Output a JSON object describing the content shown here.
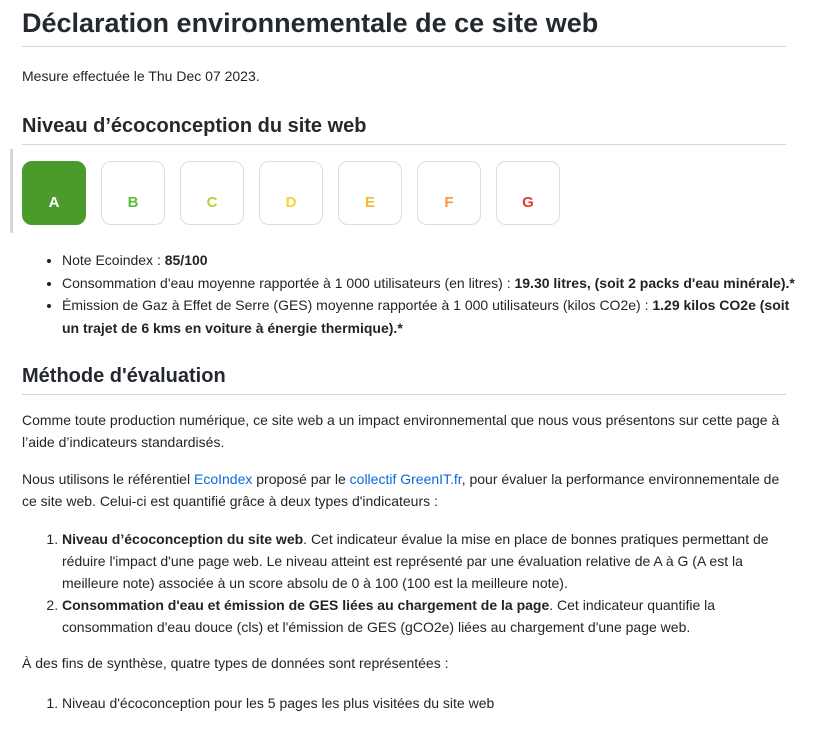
{
  "title": "Déclaration environnementale de ce site web",
  "measure_text": "Mesure effectuée le Thu Dec 07 2023.",
  "level_heading": "Niveau d’écoconception du site web",
  "grades": [
    {
      "letter": "A",
      "color": "#4a9a2c",
      "active": true
    },
    {
      "letter": "B",
      "color": "#5fbd3c",
      "active": false
    },
    {
      "letter": "C",
      "color": "#b5d334",
      "active": false
    },
    {
      "letter": "D",
      "color": "#f1d62b",
      "active": false
    },
    {
      "letter": "E",
      "color": "#f5b731",
      "active": false
    },
    {
      "letter": "F",
      "color": "#f19a40",
      "active": false
    },
    {
      "letter": "G",
      "color": "#e53935",
      "active": false
    }
  ],
  "notes": [
    {
      "text": "Note Ecoindex : ",
      "bold": "85/100"
    },
    {
      "text": "Consommation d'eau moyenne rapportée à 1 000 utilisateurs (en litres) : ",
      "bold": "19.30 litres, (soit 2 packs d'eau minérale).*"
    },
    {
      "text": "Émission de Gaz à Effet de Serre (GES) moyenne rapportée à 1 000 utilisateurs (kilos CO2e) : ",
      "bold": "1.29 kilos CO2e (soit un trajet de 6 kms en voiture à énergie thermique).*"
    }
  ],
  "method_heading": "Méthode d'évaluation",
  "para1": "Comme toute production numérique, ce site web a un impact environnemental que nous vous présentons sur cette page à l’aide d’indicateurs standardisés.",
  "para2": {
    "before": "Nous utilisons le référentiel ",
    "link1": "EcoIndex",
    "middle": " proposé par le ",
    "link2": "collectif GreenIT.fr",
    "after": ", pour évaluer la performance environnementale de ce site web. Celui-ci est quantifié grâce à deux types d'indicateurs :"
  },
  "criteria": [
    {
      "bold": "Niveau d’écoconception du site web",
      "text": ". Cet indicateur évalue la mise en place de bonnes pratiques permettant de réduire l'impact d'une page web. Le niveau atteint est représenté par une évaluation relative de A à G (A est la meilleure note) associée à un score absolu de 0 à 100 (100 est la meilleure note)."
    },
    {
      "bold": "Consommation d'eau et émission de GES liées au chargement de la page",
      "text": ". Cet indicateur quantifie la consommation d'eau douce (cls) et l'émission de GES (gCO2e) liées au chargement d'une page web."
    }
  ],
  "para3": "À des fins de synthèse, quatre types de données sont représentées :",
  "types": [
    "Niveau d'écoconception pour les 5 pages les plus visitées du site web"
  ]
}
